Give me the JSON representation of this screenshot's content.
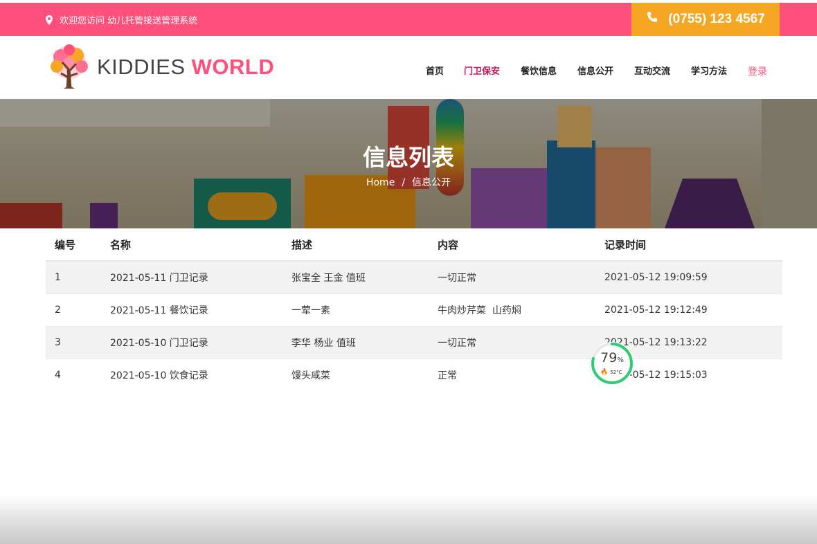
{
  "topbar": {
    "welcome": "欢迎您访问 幼儿托管接送管理系统",
    "phone": "(0755) 123 4567",
    "icons": [
      "map-pin-icon",
      "phone-icon"
    ]
  },
  "logo": {
    "word1": "KIDDIES",
    "word2": "WORLD"
  },
  "nav": {
    "items": [
      "首页",
      "门卫保安",
      "餐饮信息",
      "信息公开",
      "互动交流",
      "学习方法"
    ],
    "active": "门卫保安",
    "login": "登录"
  },
  "banner": {
    "title": "信息列表",
    "breadcrumb_home": "Home",
    "breadcrumb_sep": "/",
    "breadcrumb_current": "信息公开"
  },
  "table": {
    "headers": [
      "编号",
      "名称",
      "描述",
      "内容",
      "记录时间"
    ],
    "rows": [
      [
        "1",
        "2021-05-11 门卫记录",
        "张宝全 王金 值班",
        "一切正常",
        "2021-05-12 19:09:59"
      ],
      [
        "2",
        "2021-05-11 餐饮记录",
        "一荤一素",
        "牛肉炒芹菜  山药焖",
        "2021-05-12 19:12:49"
      ],
      [
        "3",
        "2021-05-10 门卫记录",
        "李华 杨业 值班",
        "一切正常",
        "2021-05-12 19:13:22"
      ],
      [
        "4",
        "2021-05-10 饮食记录",
        "馒头咸菜",
        "正常",
        "2021-05-12 19:15:03"
      ]
    ]
  },
  "gauge": {
    "value": "79",
    "unit": "%",
    "temp": "52°C",
    "percent": 79
  },
  "colors": {
    "brand_pink": "#ff4f7b",
    "phone_orange": "#f5a623",
    "active_nav": "#c2185b",
    "gauge_green": "#2ecc71"
  }
}
